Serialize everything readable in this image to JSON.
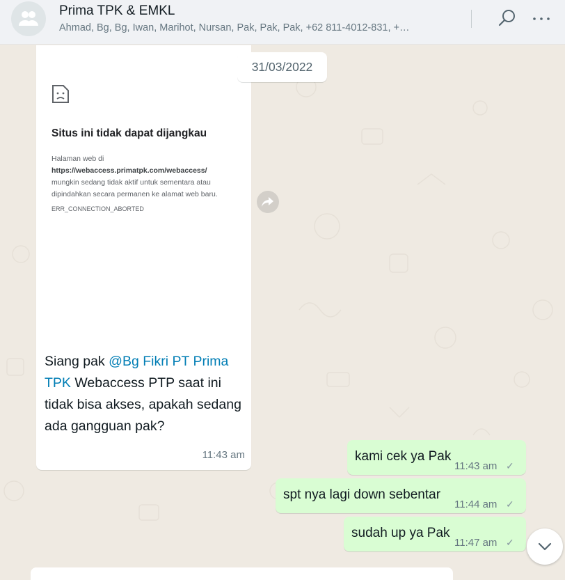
{
  "header": {
    "title": "Prima TPK & EMKL",
    "participants": "Ahmad, Bg, Bg, Iwan, Marihot, Nursan, Pak, Pak, Pak, +62 811-4012-831, +…",
    "avatar_icon": "group-icon",
    "search_icon": "search-icon",
    "menu_icon": "more-options-icon"
  },
  "date_chip": "31/03/2022",
  "incoming": {
    "screenshot": {
      "title": "Situs ini tidak dapat dijangkau",
      "line1": "Halaman web di",
      "url": "https://webaccess.primatpk.com/webaccess/",
      "line3": "mungkin sedang tidak aktif untuk sementara atau",
      "line4": "dipindahkan secara permanen ke alamat web baru.",
      "error_code": "ERR_CONNECTION_ABORTED"
    },
    "text_before": "Siang pak ",
    "mention": "@Bg Fikri PT Prima TPK",
    "text_after": " Webaccess PTP saat ini tidak bisa akses, apakah sedang ada gangguan pak?",
    "time": "11:43 am",
    "forward_icon": "forward-icon"
  },
  "outgoing": [
    {
      "text": "kami cek ya Pak",
      "time": "11:43 am",
      "status": "✓"
    },
    {
      "text": "spt nya lagi down sebentar",
      "time": "11:44 am",
      "status": "✓"
    },
    {
      "text": "sudah up ya Pak",
      "time": "11:47 am",
      "status": "✓"
    }
  ],
  "scroll_icon": "chevron-down-icon",
  "colors": {
    "chat_background": "#efeae2",
    "outgoing_bubble": "#d9fdd3",
    "incoming_bubble": "#ffffff",
    "mention": "#027eb5",
    "header": "#f0f2f5"
  }
}
